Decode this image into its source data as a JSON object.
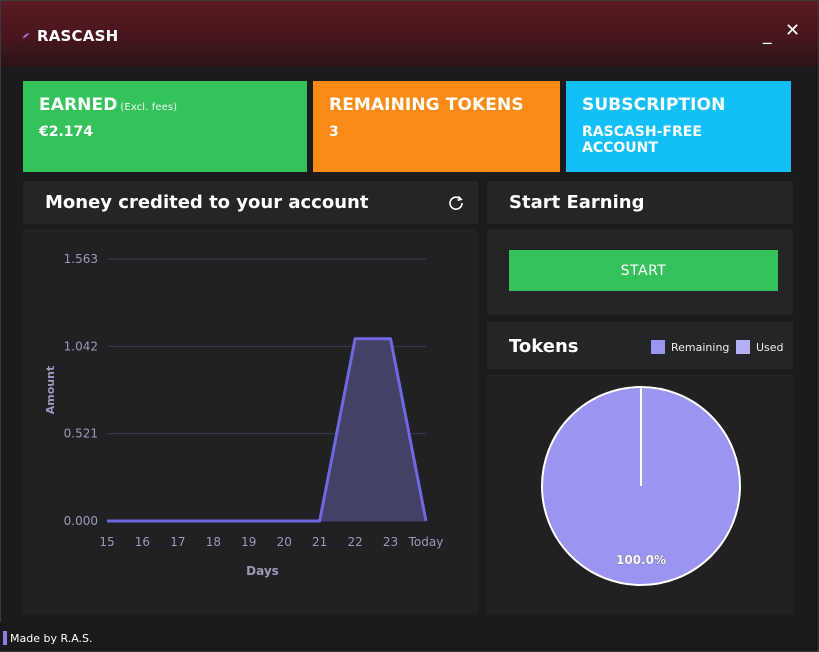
{
  "app": {
    "title": "RASCASH",
    "minimize_label": "_",
    "close_label": "✕",
    "logo_icon": "lightning-icon"
  },
  "cards": {
    "earned": {
      "title": "EARNED",
      "note": "(Excl. fees)",
      "value": "€2.174",
      "color": "#35c25a"
    },
    "tokens": {
      "title": "REMAINING TOKENS",
      "value": "3",
      "color": "#fb8a16"
    },
    "subscription": {
      "title": "SUBSCRIPTION",
      "value": "RASCASH-FREE ACCOUNT",
      "color": "#13bff7"
    }
  },
  "money_panel": {
    "title": "Money credited to your account",
    "refresh_icon": "refresh-icon"
  },
  "start_panel": {
    "title": "Start Earning",
    "button_label": "START"
  },
  "tokens_panel": {
    "title": "Tokens",
    "legend": [
      {
        "label": "Remaining",
        "color": "#9b95f2"
      },
      {
        "label": "Used",
        "color": "#b4b0f5"
      }
    ]
  },
  "footer": {
    "text": "Made by R.A.S."
  },
  "chart_data": [
    {
      "type": "area",
      "xlabel": "Days",
      "ylabel": "Amount",
      "x": [
        "15",
        "16",
        "17",
        "18",
        "19",
        "20",
        "21",
        "22",
        "23",
        "Today"
      ],
      "y_ticks": [
        "0.000",
        "0.521",
        "1.042",
        "1.563"
      ],
      "ylim": [
        0,
        1.563
      ],
      "series": [
        {
          "values": [
            0,
            0,
            0,
            0,
            0,
            0,
            0,
            1.087,
            1.087,
            0
          ]
        }
      ],
      "line_color": "#7068e0",
      "fill_color": "#46436a",
      "grid": true
    },
    {
      "type": "pie",
      "categories": [
        "Remaining",
        "Used"
      ],
      "values": [
        100,
        0
      ],
      "slice_labels": [
        "100.0%"
      ],
      "colors": [
        "#9b95f2",
        "#b4b0f5"
      ]
    }
  ]
}
